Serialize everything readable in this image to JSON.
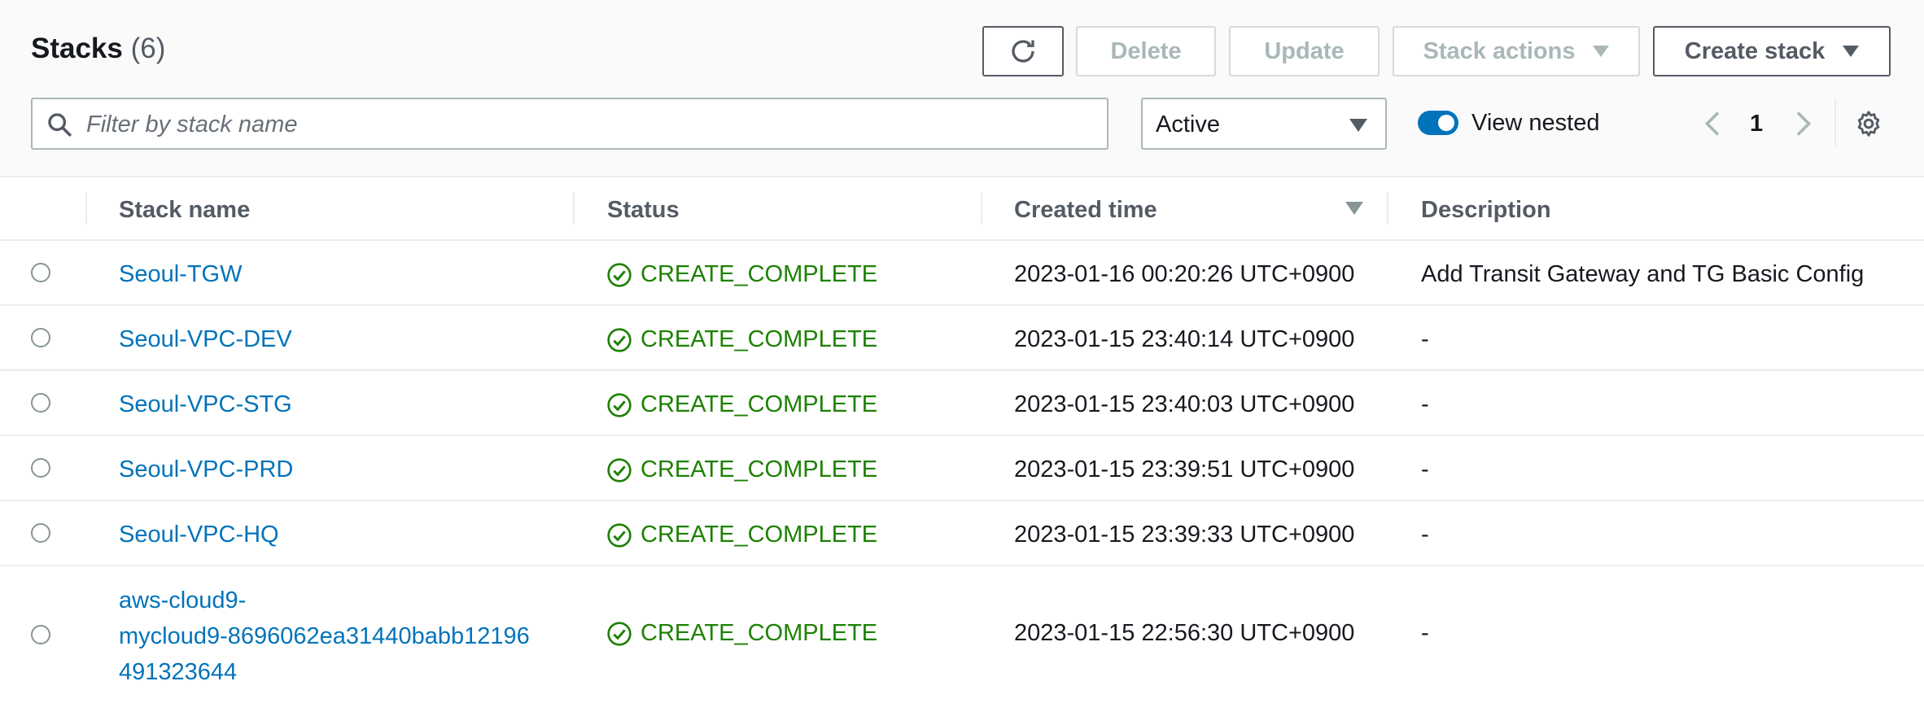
{
  "header": {
    "title": "Stacks",
    "count": "(6)",
    "buttons": {
      "delete": "Delete",
      "update": "Update",
      "stack_actions": "Stack actions",
      "create_stack": "Create stack"
    }
  },
  "filter": {
    "placeholder": "Filter by stack name",
    "status_select": "Active",
    "view_nested_label": "View nested",
    "view_nested_on": true
  },
  "pagination": {
    "current_page": "1"
  },
  "table": {
    "columns": {
      "name": "Stack name",
      "status": "Status",
      "created": "Created time",
      "description": "Description"
    },
    "rows": [
      {
        "name": "Seoul-TGW",
        "status": "CREATE_COMPLETE",
        "created": "2023-01-16 00:20:26 UTC+0900",
        "description": "Add Transit Gateway and TG Basic Config"
      },
      {
        "name": "Seoul-VPC-DEV",
        "status": "CREATE_COMPLETE",
        "created": "2023-01-15 23:40:14 UTC+0900",
        "description": "-"
      },
      {
        "name": "Seoul-VPC-STG",
        "status": "CREATE_COMPLETE",
        "created": "2023-01-15 23:40:03 UTC+0900",
        "description": "-"
      },
      {
        "name": "Seoul-VPC-PRD",
        "status": "CREATE_COMPLETE",
        "created": "2023-01-15 23:39:51 UTC+0900",
        "description": "-"
      },
      {
        "name": "Seoul-VPC-HQ",
        "status": "CREATE_COMPLETE",
        "created": "2023-01-15 23:39:33 UTC+0900",
        "description": "-"
      },
      {
        "name_lines": [
          "aws-cloud9-",
          "mycloud9-8696062ea31440babb12196",
          "491323644"
        ],
        "status": "CREATE_COMPLETE",
        "created": "2023-01-15 22:56:30 UTC+0900",
        "description": "-"
      }
    ]
  },
  "colors": {
    "link": "#0073bb",
    "success": "#1d8102",
    "toggle_on": "#0073bb"
  }
}
